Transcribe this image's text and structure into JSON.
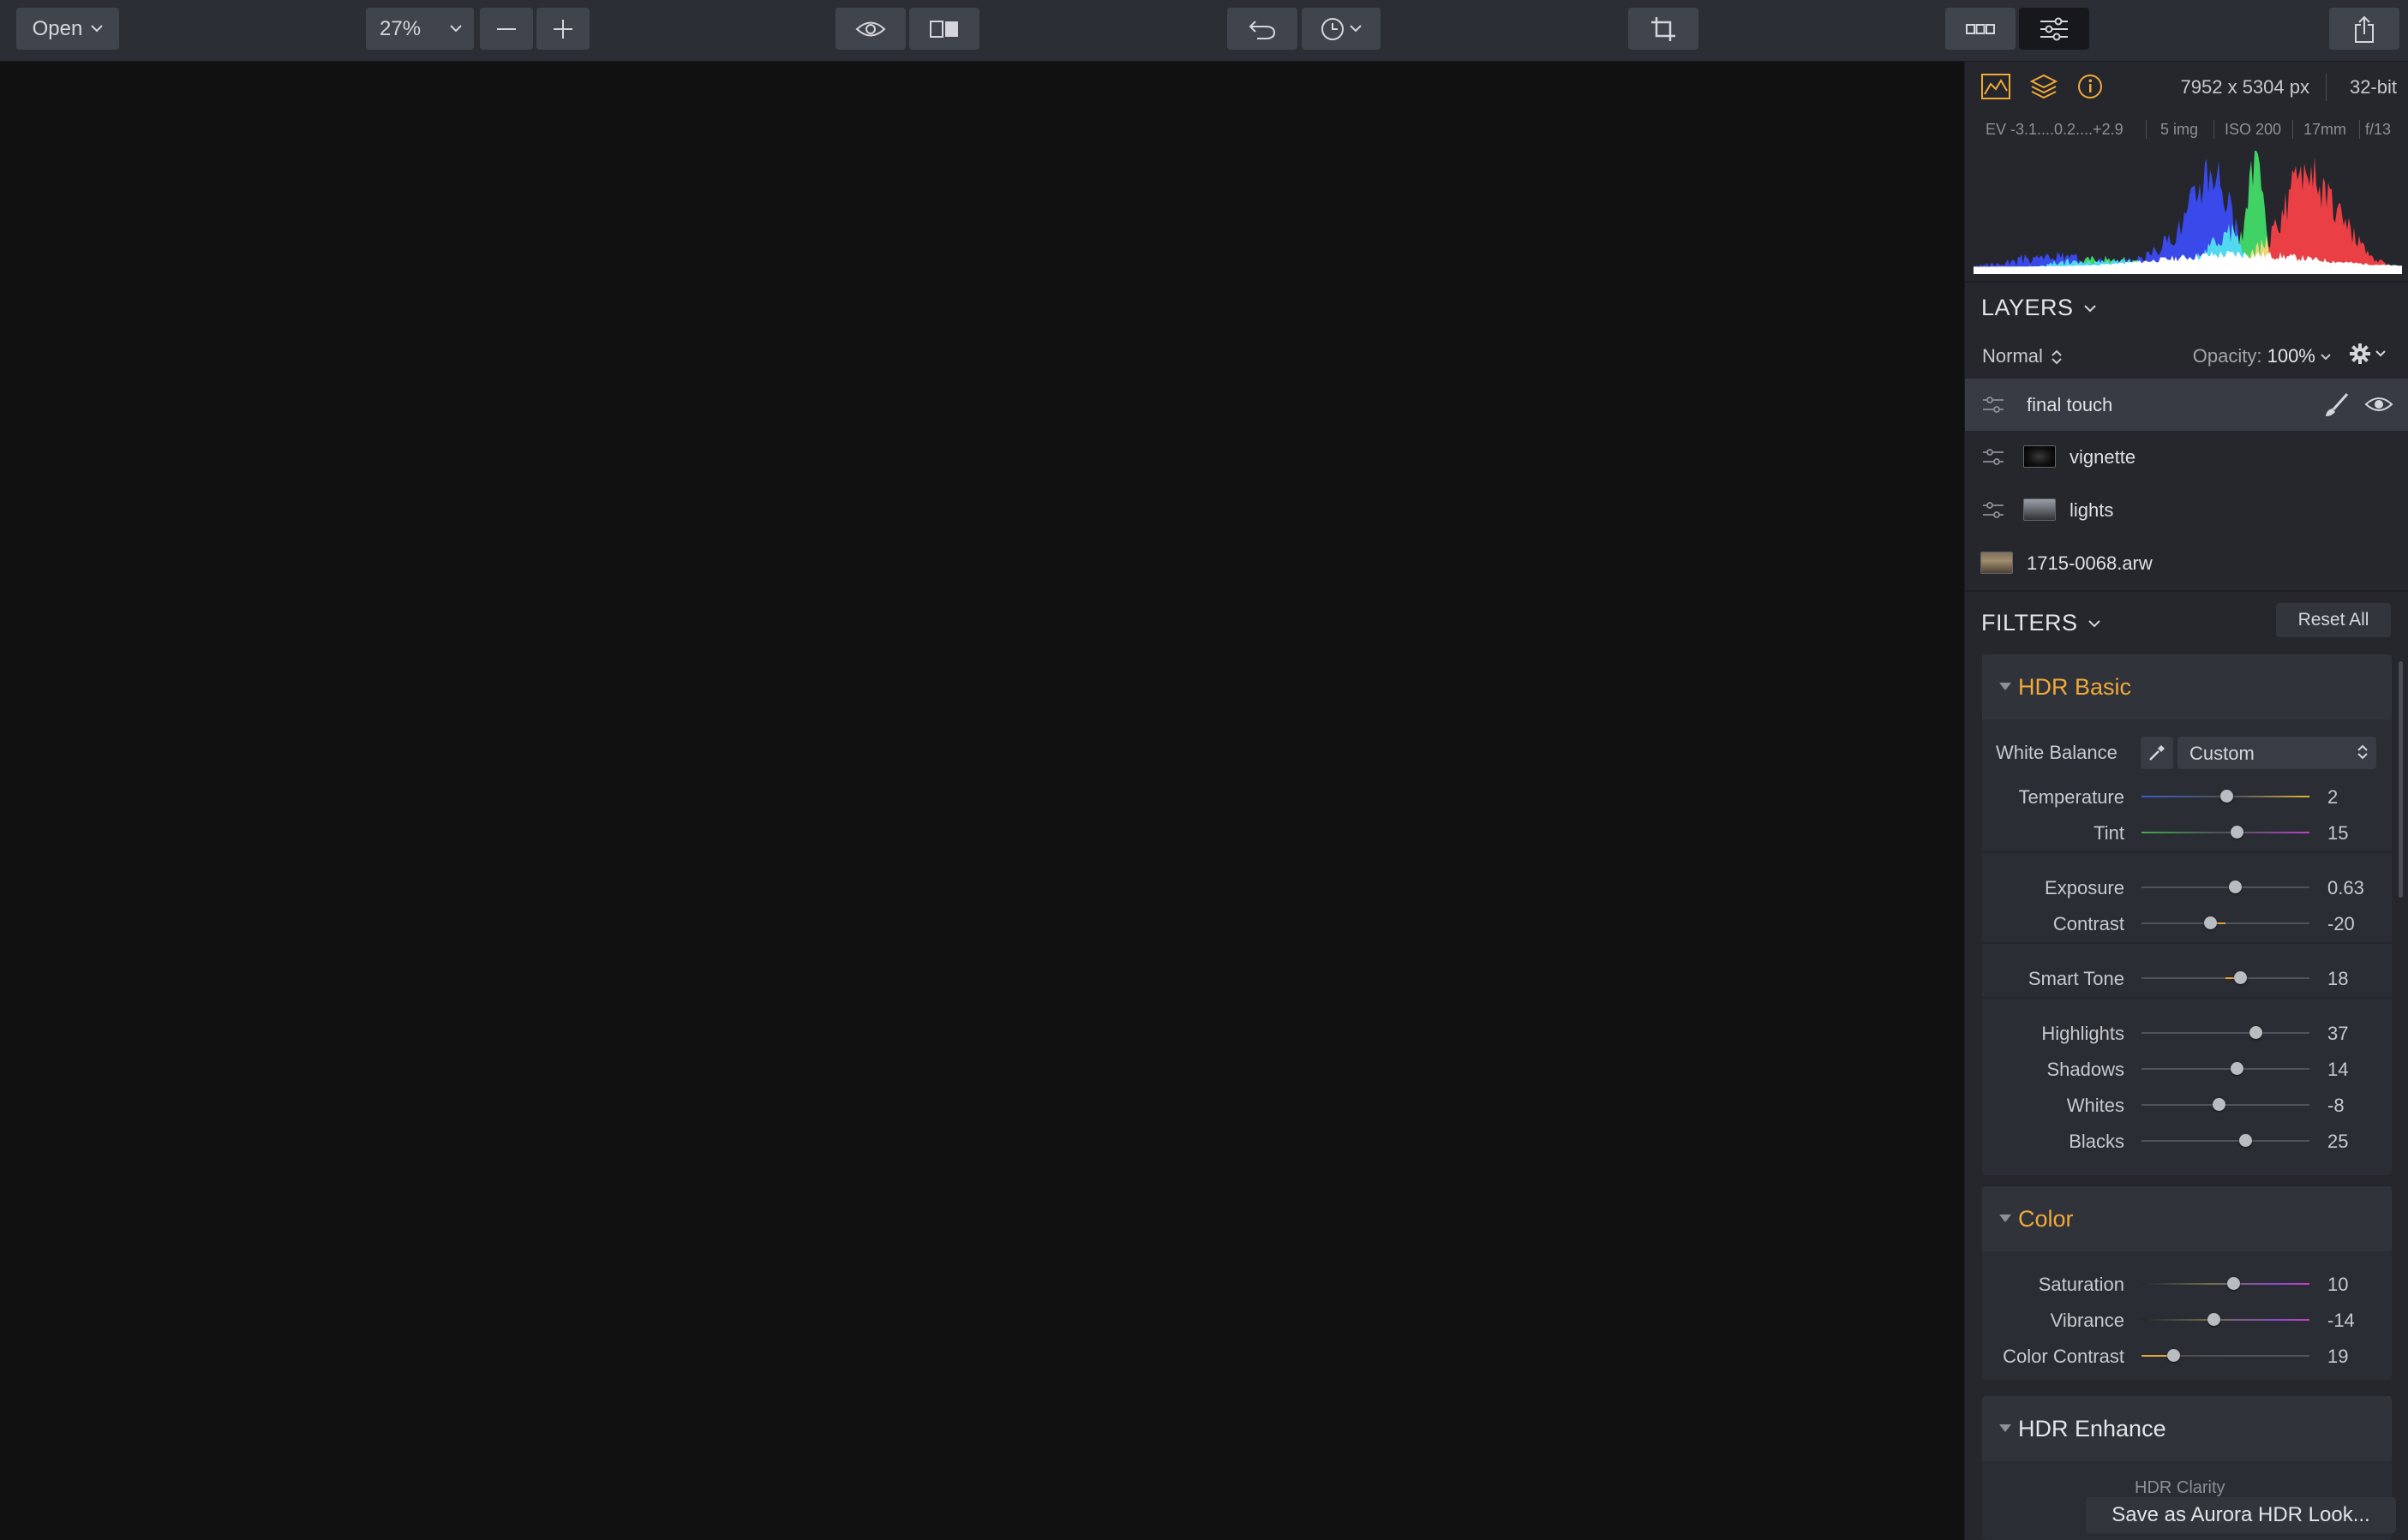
{
  "toolbar": {
    "open_label": "Open",
    "zoom_value": "27%"
  },
  "info": {
    "dimensions": "7952 x 5304 px",
    "bit_depth": "32-bit",
    "ev": "EV  -3.1....0.2....+2.9",
    "images": "5 img",
    "iso": "ISO 200",
    "focal": "17mm",
    "aperture": "f/13"
  },
  "layers": {
    "title": "LAYERS",
    "blend_mode": "Normal",
    "opacity_label": "Opacity:",
    "opacity_value": "100%",
    "items": [
      {
        "name": "final touch",
        "selected": true
      },
      {
        "name": "vignette",
        "selected": false
      },
      {
        "name": "lights",
        "selected": false
      },
      {
        "name": "1715-0068.arw",
        "selected": false
      }
    ]
  },
  "filters": {
    "title": "FILTERS",
    "reset_label": "Reset All",
    "groups": [
      {
        "title": "HDR Basic",
        "title_color": "#f0a93a",
        "white_balance_label": "White Balance",
        "white_balance_value": "Custom",
        "sliders": [
          {
            "label": "Temperature",
            "value": "2",
            "level": 0.51
          },
          {
            "label": "Tint",
            "value": "15",
            "level": 0.57
          },
          {
            "label": "Exposure",
            "value": "0.63",
            "level": 0.56
          },
          {
            "label": "Contrast",
            "value": "-20",
            "level": 0.41
          },
          {
            "label": "Smart Tone",
            "value": "18",
            "level": 0.59
          },
          {
            "label": "Highlights",
            "value": "37",
            "level": 0.68
          },
          {
            "label": "Shadows",
            "value": "14",
            "level": 0.57
          },
          {
            "label": "Whites",
            "value": "-8",
            "level": 0.46
          },
          {
            "label": "Blacks",
            "value": "25",
            "level": 0.62
          }
        ]
      },
      {
        "title": "Color",
        "title_color": "#f0a93a",
        "sliders": [
          {
            "label": "Saturation",
            "value": "10",
            "level": 0.55
          },
          {
            "label": "Vibrance",
            "value": "-14",
            "level": 0.43
          },
          {
            "label": "Color Contrast",
            "value": "19",
            "level": 0.19
          }
        ]
      },
      {
        "title": "HDR Enhance",
        "title_color": "#e3e5e8",
        "partial_label": "HDR Clarity"
      }
    ]
  },
  "save_look_label": "Save as Aurora HDR Look..."
}
